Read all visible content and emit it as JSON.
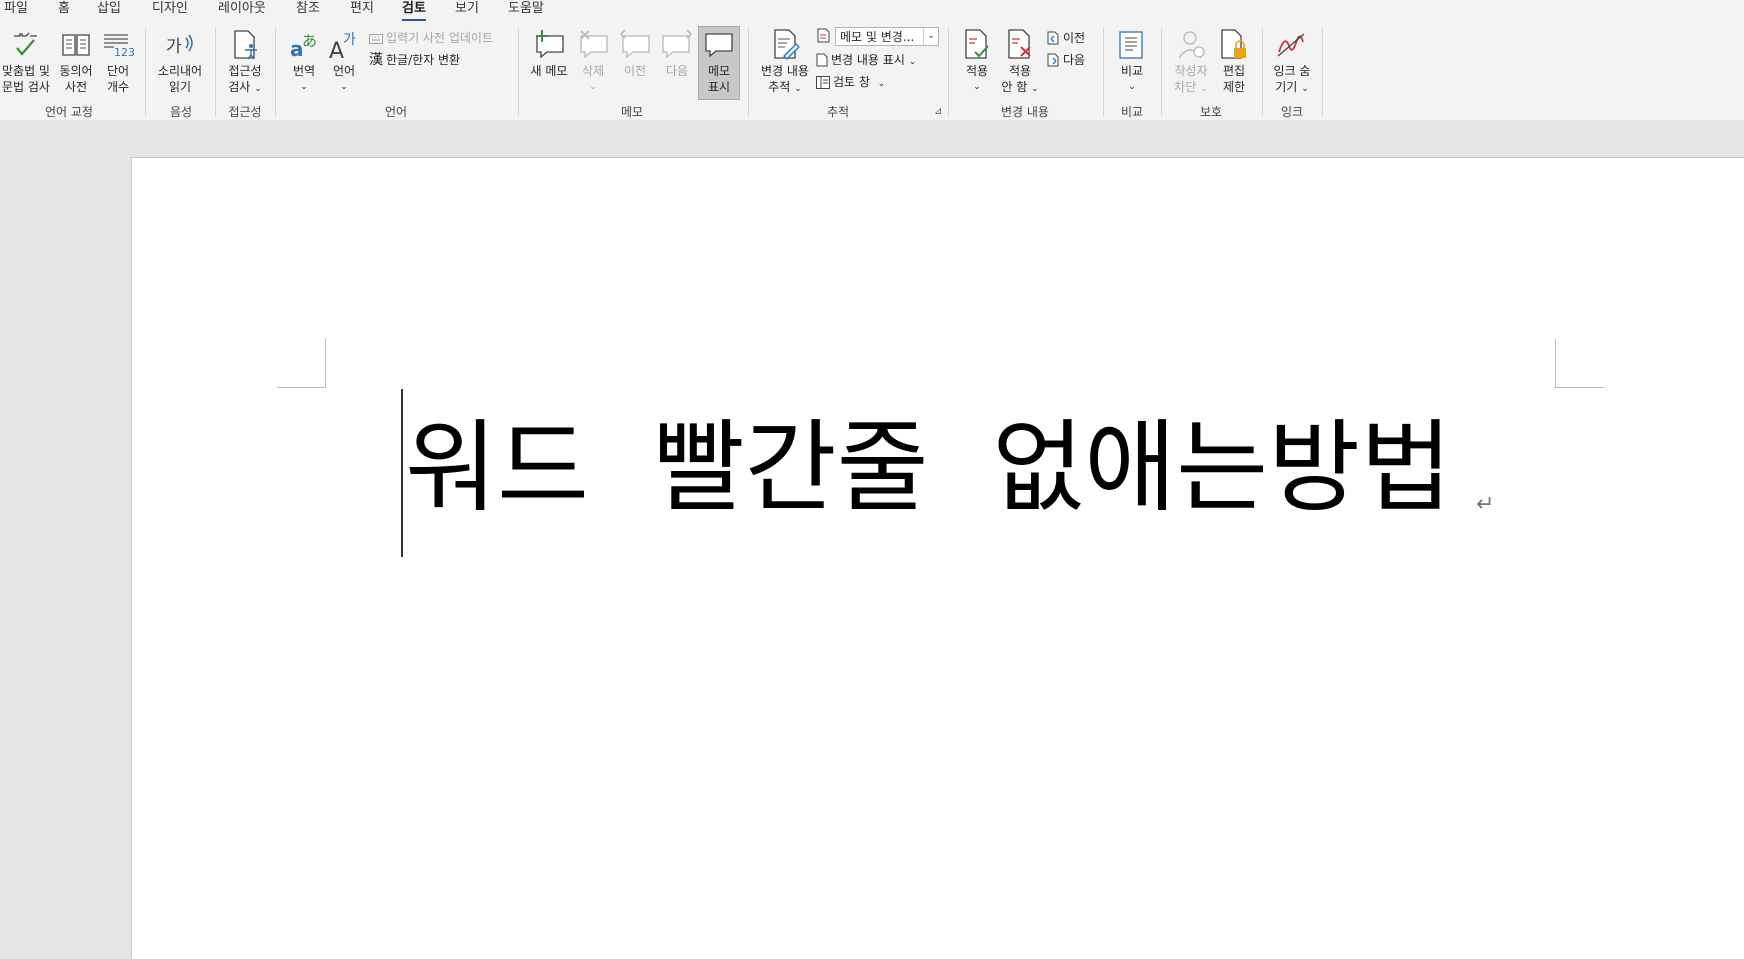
{
  "tabs": [
    "파일",
    "홈",
    "삽입",
    "디자인",
    "레이아웃",
    "참조",
    "편지",
    "검토",
    "보기",
    "도움말"
  ],
  "active_tab": "검토",
  "groups": {
    "proofing": {
      "label": "언어 교정",
      "spelling": [
        "맞춤법 및",
        "문법 검사"
      ],
      "thesaurus": [
        "동의어",
        "사전"
      ],
      "wordcount": [
        "단어",
        "개수"
      ]
    },
    "speech": {
      "label": "음성",
      "read_aloud": [
        "소리내어",
        "읽기"
      ]
    },
    "accessibility": {
      "label": "접근성",
      "check": [
        "접근성",
        "검사"
      ]
    },
    "language": {
      "label": "언어",
      "translate": "번역",
      "language": "언어",
      "ime_update": "입력기 사전 업데이트",
      "hanja": "한글/한자 변환"
    },
    "comments": {
      "label": "메모",
      "new": "새 메모",
      "delete": "삭제",
      "prev": "이전",
      "next": "다음",
      "show": [
        "메모",
        "표시"
      ]
    },
    "tracking": {
      "label": "추적",
      "track": [
        "변경 내용",
        "추적"
      ],
      "markup_combo": "메모 및 변경...",
      "show_markup": "변경 내용 표시",
      "review_pane": "검토 창"
    },
    "changes": {
      "label": "변경 내용",
      "accept": [
        "적용",
        ""
      ],
      "reject": [
        "적용",
        "안 함"
      ],
      "prev": "이전",
      "next": "다음"
    },
    "compare": {
      "label": "비교",
      "compare": "비교"
    },
    "protect": {
      "label": "보호",
      "block_authors": [
        "작성자",
        "차단"
      ],
      "restrict": [
        "편집",
        "제한"
      ]
    },
    "ink": {
      "label": "잉크",
      "hide_ink": [
        "잉크 숨",
        "기기"
      ]
    }
  },
  "document": {
    "text": "워드  빨간줄  없애는방법"
  },
  "icons": {
    "accent": "#2b579a",
    "green": "#3a8f3a",
    "red": "#d13438",
    "blue": "#2e75b6",
    "orange": "#e8a317"
  }
}
